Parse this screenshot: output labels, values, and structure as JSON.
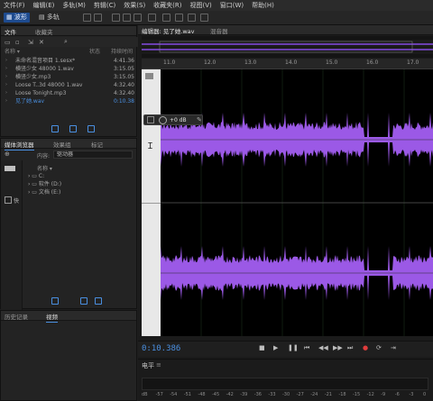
{
  "menu": [
    "文件(F)",
    "编辑(E)",
    "多轨(M)",
    "剪辑(C)",
    "效果(S)",
    "收藏夹(R)",
    "视图(V)",
    "窗口(W)",
    "帮助(H)"
  ],
  "toolbar": {
    "waveform_label": "波形",
    "multitrack_label": "多轨"
  },
  "files_panel": {
    "tabs": [
      "文件",
      "收藏夹"
    ],
    "columns": {
      "name": "名称 ▾",
      "status": "状态",
      "duration": "持续时间"
    },
    "files": [
      {
        "name": "未命名混音项目 1.sesx*",
        "duration": "4:41.36"
      },
      {
        "name": "横竖少女 48000 1.wav",
        "duration": "3:15.05"
      },
      {
        "name": "横竖少女.mp3",
        "duration": "3:15.05"
      },
      {
        "name": "Loose T..3d 48000 1.wav",
        "duration": "4:32.40"
      },
      {
        "name": "Loose Tonight.mp3",
        "duration": "4:32.40"
      },
      {
        "name": "见了她.wav",
        "duration": "0:10.38"
      }
    ]
  },
  "media_panel": {
    "tabs": [
      "媒体浏览器",
      "效果组",
      "标记"
    ],
    "content_label": "内容:",
    "content_value": "驱动器",
    "name_col": "名称 ▾",
    "drives": [
      "C:",
      "软件 (D:)",
      "文档 (E:)"
    ],
    "side_label": "快"
  },
  "history_panel": {
    "tabs": [
      "历史记录",
      "视频"
    ]
  },
  "editor": {
    "tabs": [
      "编辑器: 见了她.wav",
      "混音器"
    ],
    "ruler_ticks": [
      "11.0",
      "12.0",
      "13.0",
      "14.0",
      "15.0",
      "16.0",
      "17.0"
    ],
    "hud_gain": "+0 dB",
    "time_display": "0:10.386",
    "colors": {
      "waveform": "#9b59e6",
      "time": "#4a90e2",
      "background": "#000000"
    }
  },
  "levels_panel": {
    "title": "电平",
    "scale": [
      "dB",
      "-57",
      "-54",
      "-51",
      "-48",
      "-45",
      "-42",
      "-39",
      "-36",
      "-33",
      "-30",
      "-27",
      "-24",
      "-21",
      "-18",
      "-15",
      "-12",
      "-9",
      "-6",
      "-3",
      "0"
    ]
  }
}
